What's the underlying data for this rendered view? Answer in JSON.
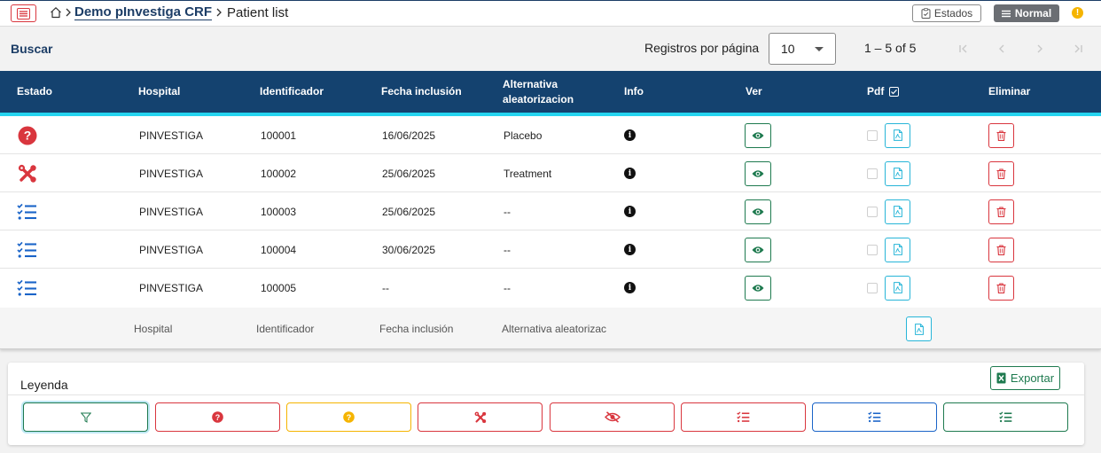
{
  "breadcrumb": {
    "project": "Demo pInvestiga CRF",
    "current": "Patient list"
  },
  "header": {
    "estados_label": "Estados",
    "mode_label": "Normal",
    "warning_glyph": "!"
  },
  "toolbar": {
    "buscar_label": "Buscar",
    "rows_per_page_label": "Registros por página",
    "rows_per_page_value": "10",
    "range_label": "1 – 5 of 5"
  },
  "table": {
    "columns": {
      "estado": "Estado",
      "hospital": "Hospital",
      "identificador": "Identificador",
      "fecha": "Fecha inclusión",
      "alternativa": "Alternativa aleatorizacion",
      "info": "Info",
      "ver": "Ver",
      "pdf": "Pdf",
      "eliminar": "Eliminar"
    },
    "rows": [
      {
        "status_icon": "question-circle-icon",
        "hospital": "PINVESTIGA",
        "id": "100001",
        "fecha": "16/06/2025",
        "alternativa": "Placebo"
      },
      {
        "status_icon": "tools-icon",
        "hospital": "PINVESTIGA",
        "id": "100002",
        "fecha": "25/06/2025",
        "alternativa": "Treatment"
      },
      {
        "status_icon": "checklist-icon",
        "hospital": "PINVESTIGA",
        "id": "100003",
        "fecha": "25/06/2025",
        "alternativa": "--"
      },
      {
        "status_icon": "checklist-icon",
        "hospital": "PINVESTIGA",
        "id": "100004",
        "fecha": "30/06/2025",
        "alternativa": "--"
      },
      {
        "status_icon": "checklist-icon",
        "hospital": "PINVESTIGA",
        "id": "100005",
        "fecha": "--",
        "alternativa": "--"
      }
    ],
    "footer": {
      "hospital": "Hospital",
      "identificador": "Identificador",
      "fecha": "Fecha inclusión",
      "alternativa": "Alternativa aleatorizac"
    }
  },
  "legend": {
    "title": "Leyenda",
    "export_label": "Exportar",
    "items": [
      {
        "icon": "filter-icon",
        "color": "#1e7a4f"
      },
      {
        "icon": "question-circle-icon",
        "color": "#d9363e"
      },
      {
        "icon": "question-circle-icon",
        "color": "#f5b400"
      },
      {
        "icon": "tools-icon",
        "color": "#d9363e"
      },
      {
        "icon": "eye-slash-icon",
        "color": "#d9363e"
      },
      {
        "icon": "checklist-icon",
        "color": "#d9363e"
      },
      {
        "icon": "checklist-icon",
        "color": "#1a64c8"
      },
      {
        "icon": "checklist-icon",
        "color": "#1e7a4f"
      }
    ]
  },
  "colors": {
    "header_bg": "#14426f",
    "header_accent": "#25d4f0",
    "danger": "#d9363e",
    "success": "#1e7a4f",
    "info": "#27b5d8",
    "primary": "#1a64c8",
    "warning": "#f5b400"
  }
}
